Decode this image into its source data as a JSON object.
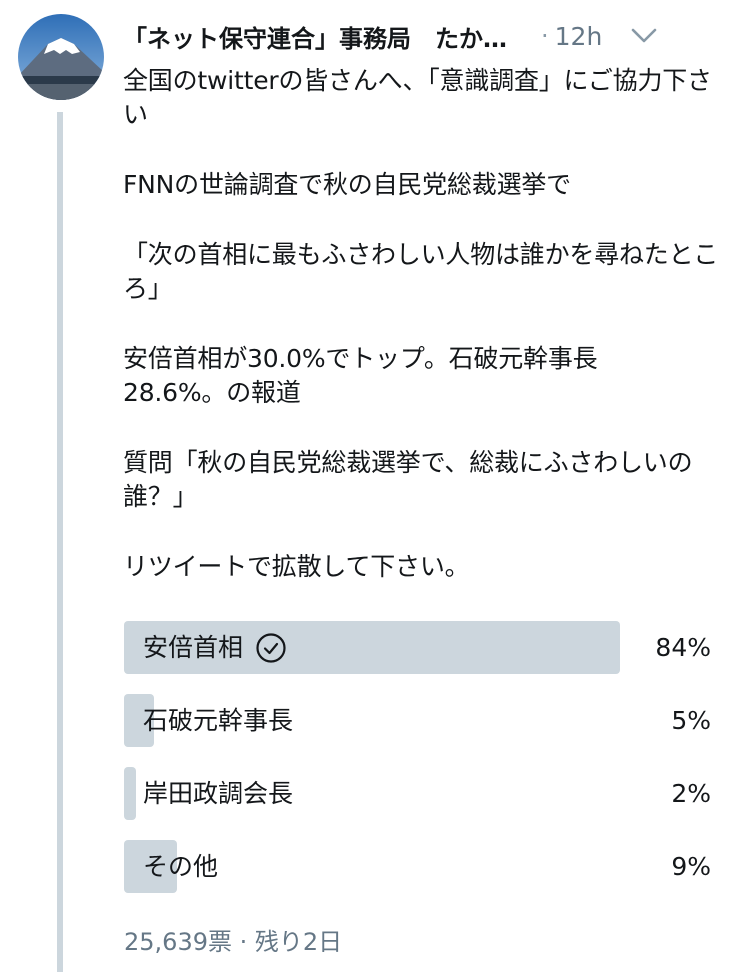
{
  "tweet": {
    "display_name": "「ネット保守連合」事務局　たか…",
    "separator": "·",
    "timestamp": "12h",
    "paragraphs": [
      "全国のtwitterの皆さんへ、「意識調査」にご協力下さい",
      "FNNの世論調査で秋の自民党総裁選挙で",
      "「次の首相に最もふさわしい人物は誰かを尋ねたところ」",
      "安倍首相が30.0%でトップ。石破元幹事長\n28.6%。の報道",
      "質問「秋の自民党総裁選挙で、総裁にふさわしいの誰？」",
      "リツイートで拡散して下さい。"
    ]
  },
  "poll": {
    "options": [
      {
        "label": "安倍首相",
        "percent_text": "84%",
        "percent": 84,
        "selected": true
      },
      {
        "label": "石破元幹事長",
        "percent_text": "5%",
        "percent": 5,
        "selected": false
      },
      {
        "label": "岸田政調会長",
        "percent_text": "2%",
        "percent": 2,
        "selected": false
      },
      {
        "label": "その他",
        "percent_text": "9%",
        "percent": 9,
        "selected": false
      }
    ],
    "footer": "25,639票 · 残り2日"
  },
  "icons": {
    "avatar": "mount-fuji-avatar",
    "caret": "chevron-down-icon",
    "check": "check-circle-icon"
  },
  "colors": {
    "poll_fill": "#ccd6dd",
    "thread_line": "#ccd6dd",
    "muted_text": "#657786"
  }
}
